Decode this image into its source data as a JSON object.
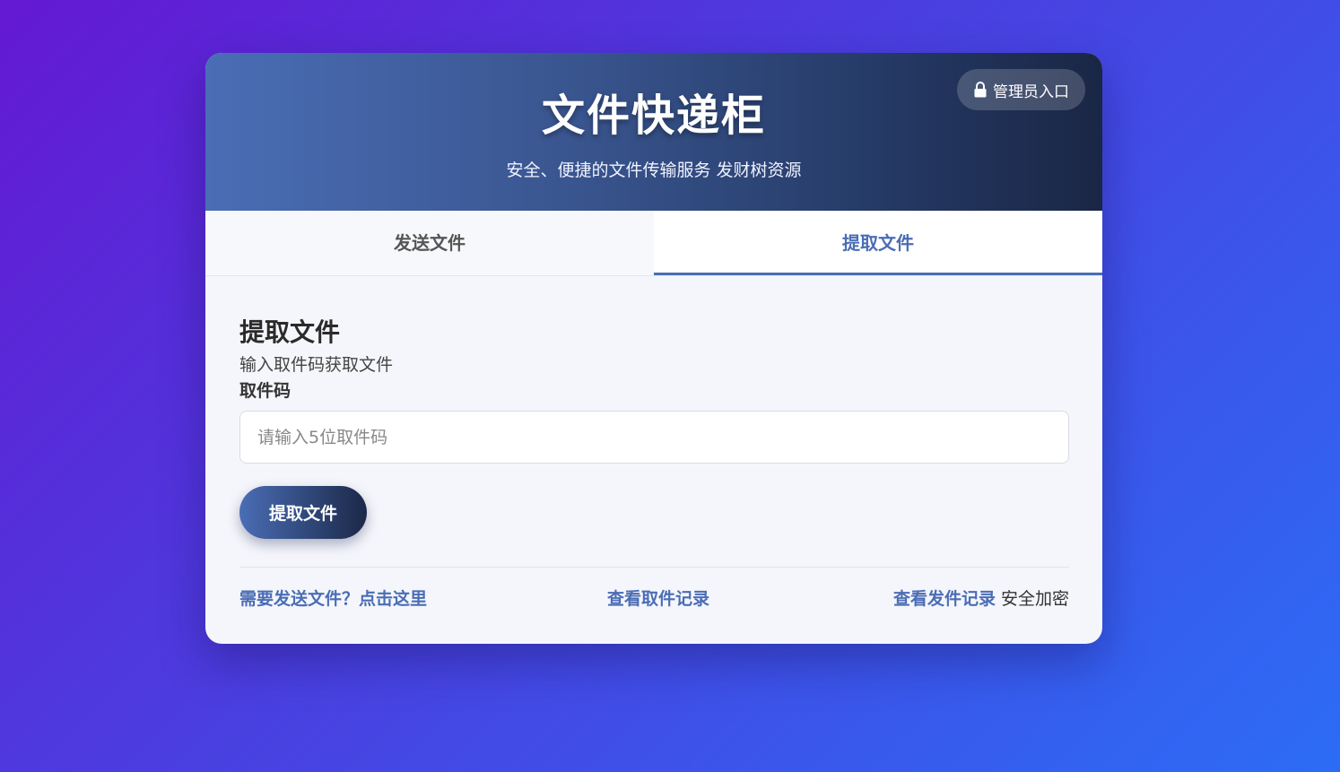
{
  "header": {
    "title": "文件快递柜",
    "subtitle": "安全、便捷的文件传输服务 发财树资源",
    "admin_label": "管理员入口"
  },
  "tabs": [
    {
      "label": "发送文件",
      "active": false
    },
    {
      "label": "提取文件",
      "active": true
    }
  ],
  "main": {
    "section_title": "提取文件",
    "section_desc": "输入取件码获取文件",
    "field_label": "取件码",
    "code_input": {
      "value": "",
      "placeholder": "请输入5位取件码"
    },
    "submit_label": "提取文件"
  },
  "footer": {
    "send_link": "需要发送文件？点击这里",
    "pickup_log_link": "查看取件记录",
    "send_log_link": "查看发件记录",
    "security_text": " 安全加密"
  },
  "colors": {
    "accent": "#4a6db5",
    "header_dark": "#1a2645"
  }
}
